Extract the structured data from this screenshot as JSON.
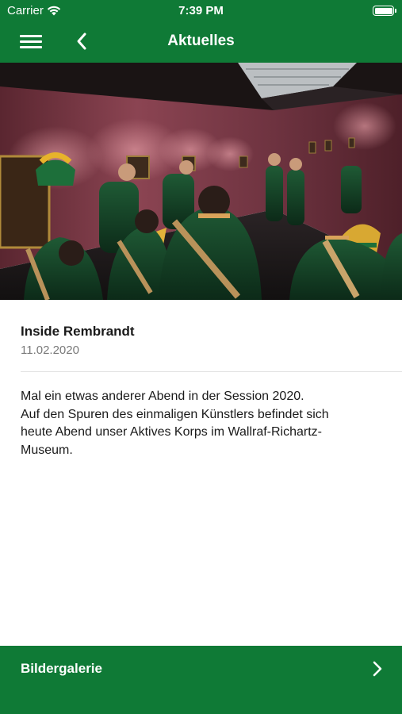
{
  "status_bar": {
    "carrier": "Carrier",
    "time": "7:39 PM",
    "icons": [
      "wifi-icon",
      "battery-icon"
    ]
  },
  "navbar": {
    "title": "Aktuelles",
    "icons": [
      "menu-icon",
      "back-chevron-icon"
    ]
  },
  "article": {
    "title": "Inside Rembrandt",
    "date": "11.02.2020",
    "body_lines": [
      "Mal ein etwas anderer Abend in der Session 2020.",
      "Auf den Spuren des einmaligen Künstlers befindet sich",
      "heute Abend unser Aktives Korps im Wallraf-Richartz-",
      "Museum."
    ]
  },
  "gallery_link": {
    "label": "Bildergalerie",
    "icon": "chevron-right-icon"
  },
  "colors": {
    "brand_green": "#0f7a36",
    "date_gray": "#7a7a7a",
    "wall_red": "#7a3a45"
  }
}
